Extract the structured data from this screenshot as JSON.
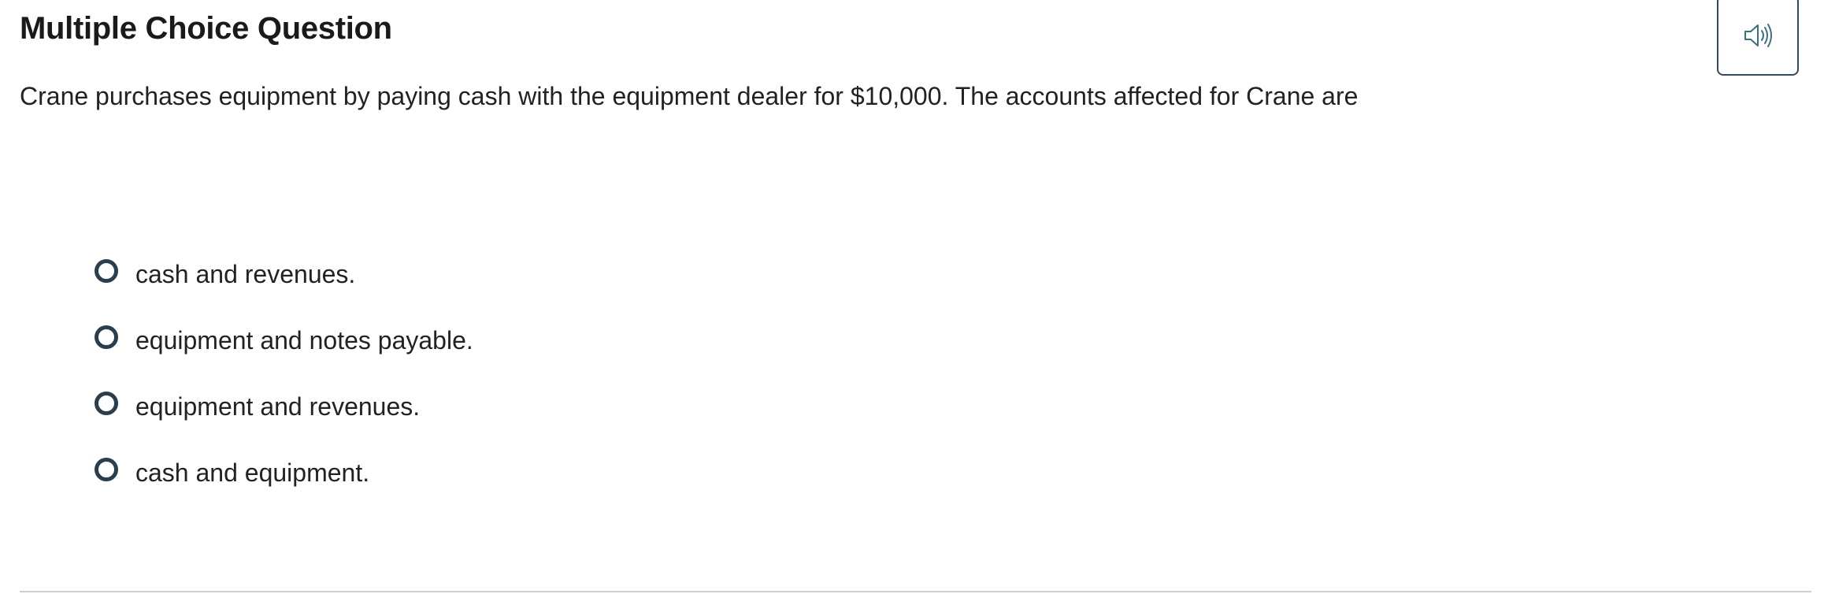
{
  "header": {
    "title": "Multiple Choice Question",
    "audio_icon": "speaker-volume-icon"
  },
  "question": {
    "text": "Crane purchases equipment by paying cash with the equipment dealer for $10,000. The accounts affected for Crane are"
  },
  "options": [
    {
      "label": "cash and revenues."
    },
    {
      "label": "equipment and notes payable."
    },
    {
      "label": "equipment and revenues."
    },
    {
      "label": "cash and equipment."
    }
  ],
  "colors": {
    "radio_border": "#2a3f4d",
    "audio_border": "#2e4a5c",
    "audio_icon": "#3a6f86",
    "divider": "#cfcfcf"
  }
}
